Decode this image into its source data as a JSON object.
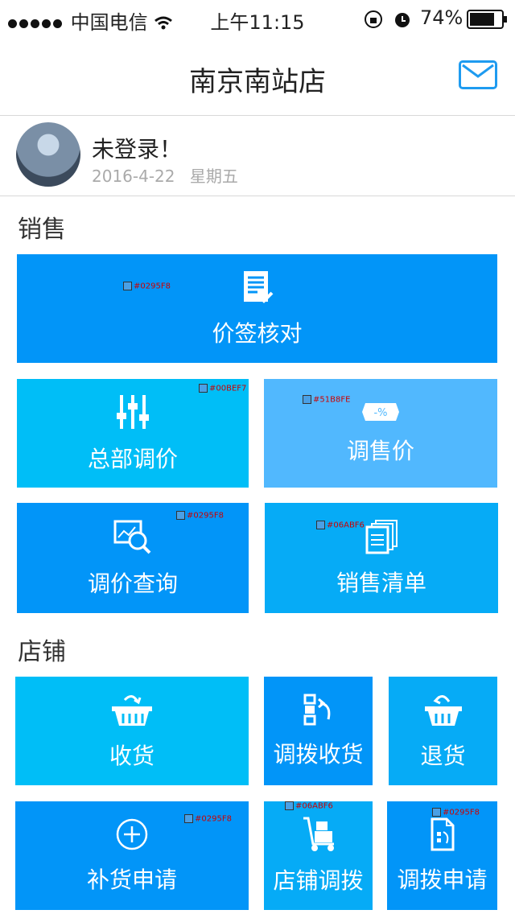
{
  "status_bar": {
    "carrier": "中国电信",
    "time": "上午11:15",
    "battery": "74%"
  },
  "header": {
    "title": "南京南站店"
  },
  "profile": {
    "login_status": "未登录！",
    "date": "2016-4-22",
    "weekday": "星期五"
  },
  "sections": {
    "sales": "销售",
    "store": "店铺"
  },
  "tiles": {
    "price_tag_check": "价签核对",
    "hq_price_adjust": "总部调价",
    "adjust_sale_price": "调售价",
    "price_adjust_query": "调价查询",
    "sales_list": "销售清单",
    "receive_goods": "收货",
    "transfer_receive": "调拨收货",
    "return_goods": "退货",
    "replenish_request": "补货申请",
    "store_transfer": "店铺调拨",
    "transfer_request": "调拨申请"
  },
  "color_tags": {
    "t1": "#0295F8",
    "t2": "#00BEF7",
    "t3": "#51B8FE",
    "t4": "#0295F8",
    "t5": "#06ABF6",
    "t6": "#0295F8",
    "t7": "#06ABF6",
    "t8": "#0295F8"
  },
  "colors": {
    "blue_dark": "#0295F8",
    "blue_cyan": "#00BEF7",
    "blue_light": "#51B8FE",
    "blue_mid": "#06ABF6"
  }
}
